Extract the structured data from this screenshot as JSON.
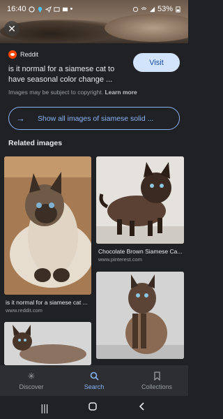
{
  "status": {
    "time": "16:40",
    "battery": "53%"
  },
  "result": {
    "source": "Reddit",
    "title": "is it normal for a siamese cat to have seasonal color change ...",
    "visit_label": "Visit",
    "copyright": "Images may be subject to copyright.",
    "learn_more": "Learn more",
    "show_all_label": "Show all images of siamese solid ..."
  },
  "related": {
    "heading": "Related images",
    "items": [
      {
        "caption": "is it normal for a siamese cat ...",
        "source": "www.reddit.com"
      },
      {
        "caption": "Chocolate Brown Siamese Ca...",
        "source": "www.pinterest.com"
      },
      {
        "caption": "",
        "source": ""
      },
      {
        "caption": "",
        "source": ""
      }
    ]
  },
  "bottom_nav": {
    "items": [
      {
        "label": "Discover",
        "icon": "asterisk-icon"
      },
      {
        "label": "Search",
        "icon": "search-icon"
      },
      {
        "label": "Collections",
        "icon": "bookmark-icon"
      }
    ]
  },
  "colors": {
    "background": "#202124",
    "accent": "#8ab4f8",
    "visit_button": "#d2e3fc",
    "reddit": "#ff4500"
  }
}
